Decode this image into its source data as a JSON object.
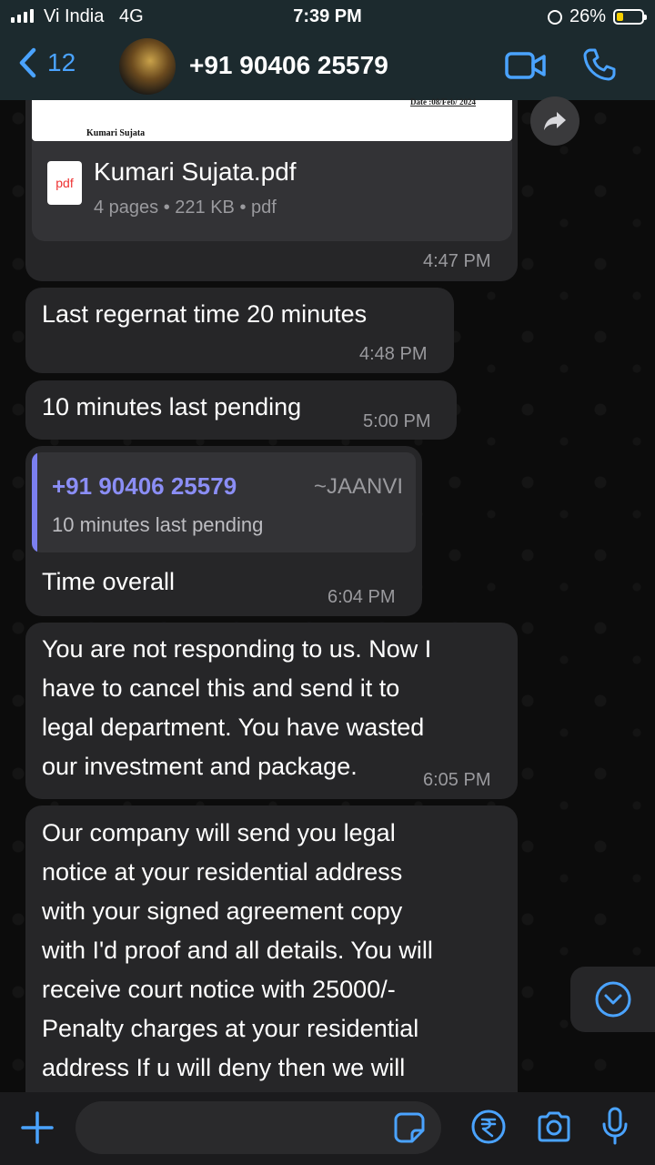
{
  "status_bar": {
    "carrier": "Vi India",
    "network": "4G",
    "time": "7:39 PM",
    "battery": "26%",
    "battery_level": 0.26
  },
  "header": {
    "back_count": "12",
    "contact_name": "+91 90406 25579"
  },
  "messages": [
    {
      "type": "document",
      "preview_date": "Date :08/Feb/ 2024",
      "preview_name": "Kumari Sujata",
      "file_icon": "pdf",
      "file_name": "Kumari Sujata.pdf",
      "file_meta": "4 pages • 221 KB • pdf",
      "time": "4:47 PM"
    },
    {
      "type": "text",
      "text": "Last regernat time 20 minutes",
      "time": "4:48 PM"
    },
    {
      "type": "text",
      "text": "10 minutes last pending",
      "time": "5:00 PM"
    },
    {
      "type": "reply",
      "quote_sender": "+91 90406 25579",
      "quote_alias": "~JAANVI",
      "quote_text": "10 minutes last pending",
      "text": "Time overall",
      "time": "6:04 PM"
    },
    {
      "type": "text",
      "lines": [
        "You are not responding to us. Now I",
        "have to cancel this and send it to",
        "legal department. You have wasted",
        "our investment and package."
      ],
      "time": "6:05 PM"
    },
    {
      "type": "text",
      "lines": [
        "Our company will send you legal",
        "notice at your residential address",
        "with your signed agreement copy",
        "with I'd proof and all details. You will",
        "receive court notice with 25000/-",
        "Penalty charges at your residential",
        "address If u will deny then we will"
      ]
    }
  ],
  "colors": {
    "accent": "#4aa3ff",
    "bubble": "#262628",
    "quote_name": "#8b8ef5",
    "battery_fill": "#f7d000"
  }
}
